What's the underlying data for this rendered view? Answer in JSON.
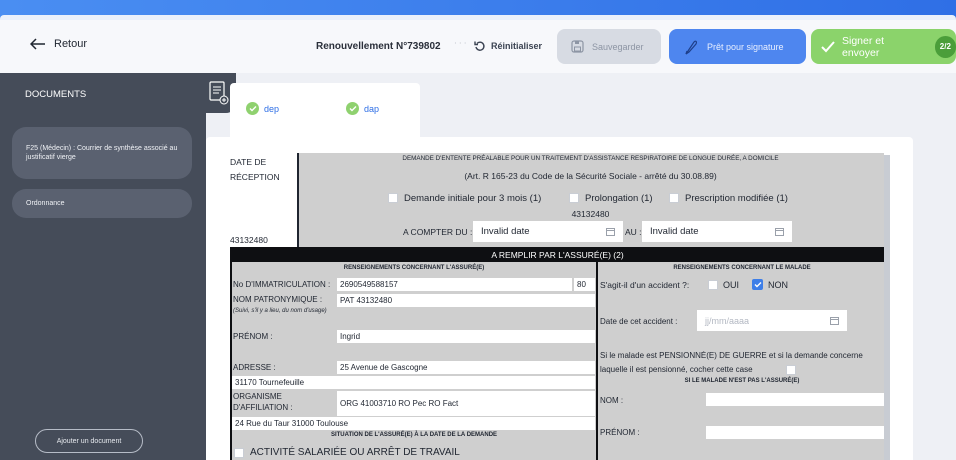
{
  "header": {
    "back_label": "Retour",
    "doc_title": "Renouvellement N°739802",
    "reset_label": "Réinitialiser",
    "save_label": "Sauvegarder",
    "ready_label": "Prêt pour signature",
    "sign_label": "Signer et envoyer",
    "step_badge": "2/2"
  },
  "sidebar": {
    "title": "DOCUMENTS",
    "items": [
      {
        "label": "F25 (Médecin) : Courrier de synthèse associé au justificatif vierge"
      },
      {
        "label": "Ordonnance"
      }
    ],
    "add_button": "Ajouter un document"
  },
  "tabs": [
    {
      "label": "dep"
    },
    {
      "label": "dap"
    }
  ],
  "form": {
    "reception_label": "DATE DE RÉCEPTION",
    "reception_number": "43132480",
    "heading": "DEMANDE D'ENTENTE PRÉALABLE POUR UN TRAITEMENT D'ASSISTANCE RESPIRATOIRE DE LONGUE DURÉE, A DOMICILE",
    "subheading": "(Art. R 165-23 du Code de la Sécurité Sociale - arrêté du 30.08.89)",
    "options": [
      "Demande initiale pour 3 mois (1)",
      "Prolongation (1)",
      "Prescription modifiée (1)"
    ],
    "ref_number": "43132480",
    "from_label": "A COMPTER DU :",
    "from_value": "Invalid date",
    "to_label": "AU :",
    "to_value": "Invalid date",
    "band": "A REMPLIR PAR L'ASSURÉ(E) (2)",
    "insured": {
      "section": "RENSEIGNEMENTS CONCERNANT L'ASSURÉ(E)",
      "immat_label": "No D'IMMATRICULATION :",
      "immat_value": "2690549588157",
      "immat_key": "80",
      "name_label": "NOM PATRONYMIQUE :",
      "name_note": "(Suivi, s'il y a lieu, du nom d'usage)",
      "name_value": "PAT 43132480",
      "first_label": "PRÉNOM :",
      "first_value": "Ingrid",
      "address_label": "ADRESSE :",
      "address_value": "25 Avenue de Gascogne",
      "city_value": "31170 Tournefeuille",
      "org_label": "ORGANISME D'AFFILIATION :",
      "org_value": "ORG 41003710 RO Pec RO Fact",
      "org_address": "24 Rue du Taur 31000 Toulouse",
      "situation_title": "SITUATION DE L'ASSURÉ(E) À LA DATE DE LA DEMANDE",
      "situation_option": "ACTIVITÉ SALARIÉE OU ARRÊT DE TRAVAIL"
    },
    "patient": {
      "section": "RENSEIGNEMENTS CONCERNANT LE MALADE",
      "accident_q": "S'agit-il d'un accident ?:",
      "yes": "OUI",
      "no": "NON",
      "accident_date_label": "Date de cet accident :",
      "accident_date_placeholder": "jj/mm/aaaa",
      "pension_text": "Si le malade est PENSIONNÉ(E) DE GUERRE et si la demande concerne",
      "pension_text2": "laquelle il est pensionné, cocher cette case",
      "not_insured": "SI LE MALADE N'EST PAS L'ASSURÉ(E)",
      "nom_label": "NOM :",
      "prenom_label": "PRÉNOM :"
    }
  }
}
